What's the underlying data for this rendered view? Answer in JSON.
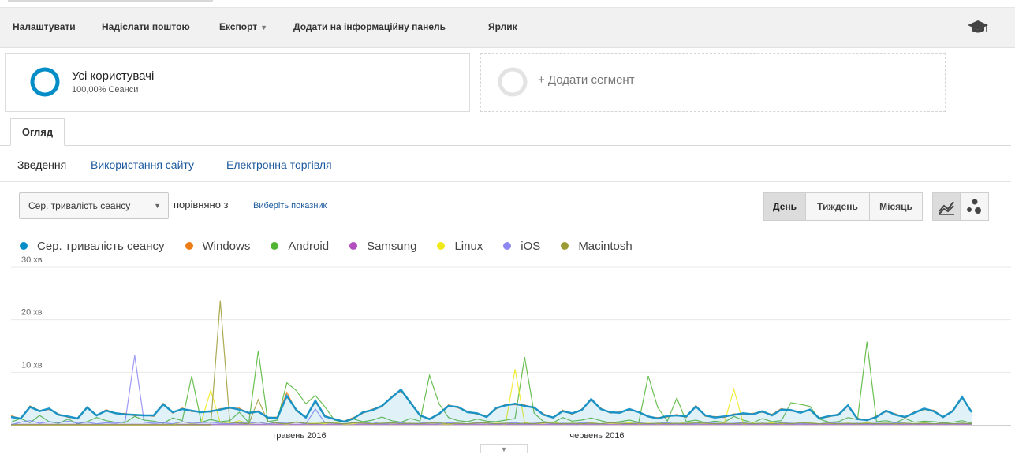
{
  "toolbar": {
    "customize": "Налаштувати",
    "email": "Надіслати поштою",
    "export": "Експорт",
    "add_to_dashboard": "Додати на інформаційну панель",
    "shortcut": "Ярлик",
    "help_icon": "graduation-cap-icon"
  },
  "segments": {
    "active": {
      "title": "Усі користувачі",
      "subtitle": "100,00% Сеанси",
      "color": "#058dc7"
    },
    "add": {
      "label": "+ Додати сегмент"
    }
  },
  "tabs": {
    "active": "Огляд"
  },
  "subnav": {
    "summary": "Зведення",
    "site_usage": "Використання сайту",
    "ecommerce": "Електронна торгівля"
  },
  "controls": {
    "metric_select": "Сер. тривалість сеансу",
    "compare_text": "порівняно з",
    "choose_metric": "Виберіть показник",
    "granularity": [
      "День",
      "Тиждень",
      "Місяць"
    ],
    "granularity_active": "День",
    "chart_type_icons": [
      "line-chart-icon",
      "motion-chart-icon"
    ]
  },
  "chart_data": {
    "type": "line",
    "y_unit": "хв",
    "ylim": [
      0,
      30
    ],
    "yticks": [
      {
        "value": 10,
        "label": "10 хв"
      },
      {
        "value": 20,
        "label": "20 хв"
      },
      {
        "value": 30,
        "label": "30 хв"
      }
    ],
    "x_start": "2016-04-01",
    "x_end": "2016-07-10",
    "xticks": [
      {
        "date": "2016-05-01",
        "label": "травень 2016"
      },
      {
        "date": "2016-06-01",
        "label": "червень 2016"
      }
    ],
    "grid": true,
    "legend_position": "top-left",
    "series": [
      {
        "name": "Сер. тривалість сеансу",
        "color": "#058dc7",
        "fill": true,
        "values": [
          1.5,
          1.2,
          3.4,
          2.6,
          3.1,
          1.9,
          1.6,
          1.2,
          3.3,
          1.8,
          2.7,
          2.2,
          2,
          1.9,
          1.8,
          1.8,
          3.9,
          2.4,
          3,
          2.7,
          2.4,
          2.6,
          2.9,
          3.3,
          2.9,
          2.3,
          2.5,
          1.4,
          1.3,
          5.5,
          2.8,
          1.4,
          4.6,
          1.6,
          1.1,
          0.6,
          1.2,
          2.4,
          2.8,
          3.6,
          5.2,
          6.7,
          4.2,
          1.8,
          1.1,
          2.1,
          3.6,
          3.4,
          2.4,
          2.2,
          1.5,
          3.2,
          3.7,
          4,
          3.6,
          3.3,
          1.9,
          1.4,
          2.6,
          2.2,
          2.8,
          4.9,
          3,
          2.4,
          2.3,
          3,
          2.4,
          1.6,
          1.2,
          1.7,
          1.8,
          1.6,
          3.5,
          1.8,
          1.4,
          1.6,
          1.9,
          2.2,
          2,
          2.6,
          1.8,
          2.9,
          2.8,
          2.3,
          2.9,
          1.2,
          1.7,
          1.9,
          3.7,
          1.1,
          0.9,
          1.5,
          2.7,
          1.9,
          1.5,
          2.3,
          3.1,
          2.6,
          1.5,
          2.6,
          5.3,
          2.4
        ]
      },
      {
        "name": "Windows",
        "color": "#ed7e17",
        "fill": false,
        "values": [
          1.8,
          1.1,
          3.6,
          2.7,
          2.9,
          2.1,
          1.4,
          1.3,
          3.4,
          1.7,
          2.9,
          2.1,
          2.2,
          1.7,
          1.9,
          1.6,
          4.1,
          2.2,
          3.2,
          2.5,
          2.6,
          2.4,
          3.1,
          3.1,
          3.2,
          2.1,
          2.7,
          1.3,
          1.5,
          6.2,
          2.6,
          1.5,
          4.3,
          1.8,
          1,
          0.7,
          1.4,
          2.2,
          3,
          3.4,
          5.4,
          6.4,
          4.4,
          1.7,
          1.2,
          1.9,
          3.8,
          3.2,
          2.6,
          2,
          1.7,
          3,
          3.9,
          3.8,
          3.8,
          3.1,
          2.1,
          1.3,
          2.8,
          2,
          3,
          4.7,
          3.2,
          2.2,
          2.5,
          2.8,
          2.6,
          1.5,
          1.4,
          1.5,
          2,
          1.4,
          3.7,
          1.6,
          1.6,
          1.4,
          2.1,
          2,
          2.2,
          2.4,
          2,
          3.1,
          2.6,
          2.5,
          2.7,
          1.4,
          1.5,
          2.1,
          3.5,
          1.3,
          0.8,
          1.7,
          2.5,
          2.1,
          1.3,
          2.5,
          2.9,
          2.8,
          1.4,
          2.8,
          5.1,
          2.6
        ]
      },
      {
        "name": "Android",
        "color": "#50b432",
        "fill": false,
        "values": [
          0.5,
          1.2,
          0.4,
          1.8,
          0.6,
          0.3,
          1.1,
          0.2,
          0.6,
          1.4,
          0.8,
          0.5,
          0.4,
          1.6,
          0.9,
          0.7,
          0.3,
          1.3,
          0.8,
          9.3,
          0.5,
          1,
          0.6,
          0.8,
          2.4,
          0.4,
          14.1,
          0.6,
          0.9,
          8,
          6.5,
          4,
          5.6,
          3.4,
          0.9,
          0.5,
          1.1,
          0.6,
          0.9,
          1.5,
          0.8,
          0.5,
          1.2,
          0.7,
          9.4,
          4,
          1.4,
          0.8,
          0.6,
          1.1,
          0.7,
          0.6,
          0.9,
          1.2,
          12.9,
          2.2,
          0.6,
          0.4,
          1.4,
          0.7,
          0.9,
          1.3,
          0.8,
          0.4,
          0.6,
          0.9,
          0.5,
          9.3,
          3.3,
          0.7,
          5.1,
          0.6,
          0.9,
          0.4,
          0.7,
          0.5,
          1.6,
          0.9,
          0.4,
          1.2,
          0.6,
          0.8,
          4.2,
          3.9,
          3.5,
          1.1,
          0.5,
          0.6,
          1.4,
          1,
          15.8,
          0.6,
          0.8,
          0.4,
          1.2,
          0.5,
          0.7,
          0.6,
          0.4,
          0.5,
          0.8,
          0.3
        ]
      },
      {
        "name": "Samsung",
        "color": "#b34ec1",
        "fill": false,
        "values": [
          0.1,
          0.1,
          0.1,
          0.1,
          0.1,
          0.1,
          0.1,
          0.1,
          0.1,
          0.1,
          0.1,
          0.1,
          0.1,
          0.1,
          0.1,
          0.1,
          0.1,
          0.1,
          0.1,
          0.1,
          0.1,
          0.1,
          0.1,
          0.1,
          0.1,
          0.1,
          0.1,
          0.1,
          0.1,
          0.1,
          0.1,
          0.1,
          0.1,
          0.1,
          0.1,
          0.1,
          0.1,
          0.1,
          0.1,
          0.1,
          0.1,
          0.1,
          0.1,
          0.1,
          0.1,
          0.1,
          0.1,
          0.1,
          0.1,
          0.1,
          0.1,
          0.1,
          0.1,
          0.1,
          0.1,
          0.1,
          0.1,
          0.1,
          0.1,
          0.1,
          0.1,
          0.1,
          0.1,
          0.1,
          0.1,
          0.1,
          0.1,
          0.1,
          0.1,
          0.1,
          0.1,
          0.1,
          0.1,
          0.1,
          0.1,
          0.1,
          0.1,
          0.1,
          0.1,
          0.1,
          0.1,
          0.1,
          0.1,
          0.1,
          0.1,
          0.1,
          0.1,
          0.1,
          0.1,
          0.1,
          0.1,
          0.1,
          0.1,
          0.1,
          0.1,
          0.1,
          0.1,
          0.1,
          0.1,
          0.1,
          0.1,
          0.1
        ]
      },
      {
        "name": "Linux",
        "color": "#f0e917",
        "fill": false,
        "values": [
          0,
          0,
          0,
          0,
          0,
          0,
          0,
          0,
          0,
          0,
          0,
          0,
          0,
          0,
          0,
          0,
          0,
          0,
          0.6,
          0.2,
          0.5,
          6.6,
          0.4,
          0.3,
          0.8,
          0.2,
          0.5,
          0.2,
          0.4,
          0.1,
          0.6,
          0.2,
          0.3,
          0.2,
          0.5,
          0.1,
          0.2,
          0.4,
          0.2,
          0.3,
          0.2,
          0.5,
          0.2,
          0.3,
          0.4,
          0.2,
          0.1,
          0.3,
          0.2,
          0.5,
          0.2,
          0.3,
          0.2,
          10.6,
          0.4,
          0.2,
          0.3,
          0.5,
          0.2,
          0.3,
          0.2,
          0.4,
          0.2,
          0.3,
          0.2,
          0.4,
          0.2,
          0.3,
          0.2,
          0.3,
          0.2,
          0.5,
          0.2,
          0.3,
          0.2,
          0.4,
          6.8,
          0.2,
          0.3,
          0.2,
          0.4,
          0.2,
          0.3,
          0.2,
          0.4,
          0.2,
          0.3,
          0.2,
          0.3,
          0.2,
          0.4,
          0.2,
          0.3,
          0.2,
          0.3,
          0.2,
          0.4,
          0.2,
          0.3,
          0.2,
          0.3,
          0.2
        ]
      },
      {
        "name": "iOS",
        "color": "#8d87f2",
        "fill": false,
        "values": [
          0,
          0.5,
          0.8,
          0.3,
          0.6,
          0.4,
          0.7,
          0.3,
          0.5,
          0.2,
          0.4,
          0.3,
          0.6,
          13.2,
          0.5,
          0.3,
          0.4,
          0.2,
          0.6,
          0.3,
          0.4,
          0.5,
          0.3,
          0.2,
          0.4,
          0.3,
          0.5,
          0.2,
          0.4,
          0.3,
          0.5,
          0.2,
          3,
          0.4,
          0.3,
          0.2,
          0.4,
          0.3,
          0.5,
          0.2,
          0.3,
          0.4,
          0.2,
          0.3,
          0.5,
          0.2,
          0.4,
          0.3,
          0.2,
          0.4,
          0.3,
          0.2,
          0.3,
          0.4,
          0.2,
          0.3,
          0.4,
          0.2,
          0.3,
          0.2,
          0.4,
          0.3,
          0.2,
          0.4,
          0.3,
          0.2,
          0.4,
          0.2,
          0.3,
          0.4,
          0.2,
          0.3,
          0.2,
          0.4,
          0.3,
          0.2,
          0.3,
          0.4,
          0.2,
          0.3,
          0.2,
          0.4,
          0.3,
          0.2,
          0.3,
          0.2,
          0.4,
          0.3,
          0.2,
          0.3,
          0.2,
          0.3,
          0.2,
          0.4,
          0.3,
          0.2,
          0.3,
          0.2,
          0.3,
          0.2,
          0.3,
          0.2
        ]
      },
      {
        "name": "Macintosh",
        "color": "#9c9b33",
        "fill": false,
        "values": [
          0,
          0,
          0,
          0,
          0,
          0,
          0,
          0,
          0,
          0,
          0,
          0,
          0,
          0,
          0,
          0,
          0,
          0,
          0,
          0,
          0,
          0,
          23.6,
          0.5,
          0.3,
          0.2,
          4.8,
          0.6,
          0.3,
          0.2,
          0.5,
          0.3,
          0.2,
          0.4,
          0.3,
          0.2,
          0.4,
          0.3,
          0.2,
          0.3,
          0.4,
          0.2,
          0.3,
          0.2,
          0.3,
          0.4,
          0.2,
          0.3,
          0.2,
          0.3,
          0.4,
          0.2,
          0.3,
          0.2,
          0.3,
          0.2,
          0.4,
          0.3,
          0.2,
          0.3,
          0.2,
          0.3,
          0.2,
          0.4,
          0.3,
          0.2,
          0.3,
          0.2,
          0.3,
          0.2,
          0.3,
          0.2,
          0.4,
          0.3,
          0.2,
          0.3,
          0.2,
          0.3,
          0.2,
          0.3,
          0.2,
          0.3,
          0.2,
          0.4,
          0.3,
          0.2,
          0.3,
          0.2,
          0.3,
          0.2,
          0.3,
          0.2,
          0.3,
          0.2,
          0.3,
          0.2,
          0.3,
          0.2,
          0.3,
          0.2,
          0.3,
          0.2
        ]
      }
    ]
  }
}
